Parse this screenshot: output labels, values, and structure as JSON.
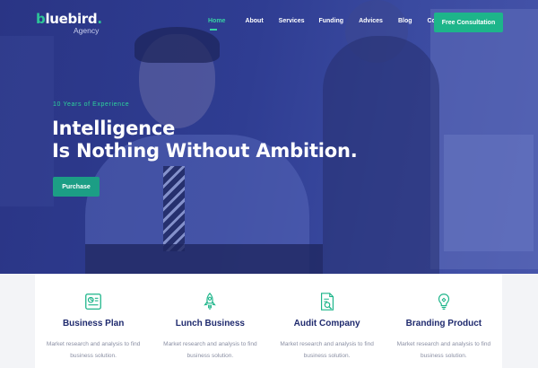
{
  "brand": {
    "logo_first": "b",
    "logo_rest": "luebird",
    "logo_dot": ".",
    "tagline": "Agency"
  },
  "nav": {
    "items": [
      {
        "label": "Home",
        "active": true
      },
      {
        "label": "About",
        "active": false
      },
      {
        "label": "Services",
        "active": false
      },
      {
        "label": "Funding",
        "active": false
      },
      {
        "label": "Advices",
        "active": false
      },
      {
        "label": "Blog",
        "active": false
      },
      {
        "label": "Contact",
        "active": false
      }
    ],
    "cta_label": "Free Consultation"
  },
  "hero": {
    "eyebrow": "10 Years of Experience",
    "headline_line1": "Intelligence",
    "headline_line2": "Is Nothing Without Ambition.",
    "button_label": "Purchase"
  },
  "services": [
    {
      "icon": "business-plan-icon",
      "title": "Business Plan",
      "desc_line1": "Market research and analysis to find",
      "desc_line2": "business solution."
    },
    {
      "icon": "rocket-icon",
      "title": "Lunch Business",
      "desc_line1": "Market research and analysis to find",
      "desc_line2": "business solution."
    },
    {
      "icon": "audit-document-icon",
      "title": "Audit Company",
      "desc_line1": "Market research and analysis to find",
      "desc_line2": "business solution."
    },
    {
      "icon": "lightbulb-icon",
      "title": "Branding Product",
      "desc_line1": "Market research and analysis to find",
      "desc_line2": "business solution."
    }
  ],
  "colors": {
    "accent": "#1db58a",
    "hero_overlay": "#2f3d92",
    "title": "#1f2a6e"
  }
}
